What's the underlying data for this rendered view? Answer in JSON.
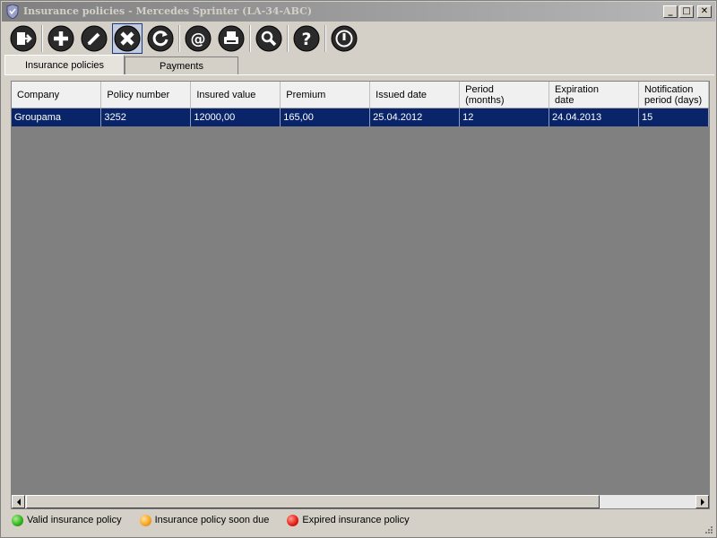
{
  "window": {
    "title": "Insurance policies - Mercedes Sprinter (LA-34-ABC)",
    "minimize": "_",
    "maximize": "□",
    "close": "✕"
  },
  "toolbar": {
    "buttons": [
      {
        "name": "exit-icon"
      },
      {
        "name": "add-icon"
      },
      {
        "name": "edit-icon"
      },
      {
        "name": "delete-icon"
      },
      {
        "name": "refresh-icon"
      },
      {
        "name": "email-icon"
      },
      {
        "name": "print-icon"
      },
      {
        "name": "search-icon"
      },
      {
        "name": "help-icon"
      },
      {
        "name": "power-icon"
      }
    ]
  },
  "tabs": [
    "Insurance policies",
    "Payments"
  ],
  "table": {
    "columns": [
      "Company",
      "Policy number",
      "Insured value",
      "Premium",
      "Issued date",
      "Period\n(months)",
      "Expiration\ndate",
      "Notification\nperiod (days)"
    ],
    "rows": [
      [
        "Groupama",
        "3252",
        "12000,00",
        "165,00",
        "25.04.2012",
        "12",
        "24.04.2013",
        "15"
      ]
    ]
  },
  "legend": [
    {
      "label": "Valid insurance policy",
      "color": "#2fae1a"
    },
    {
      "label": "Insurance policy soon due",
      "color": "#f6a21d"
    },
    {
      "label": "Expired insurance policy",
      "color": "#e21b12"
    }
  ],
  "colors": {
    "selection": "#0a246a",
    "grid_background": "#808080"
  }
}
